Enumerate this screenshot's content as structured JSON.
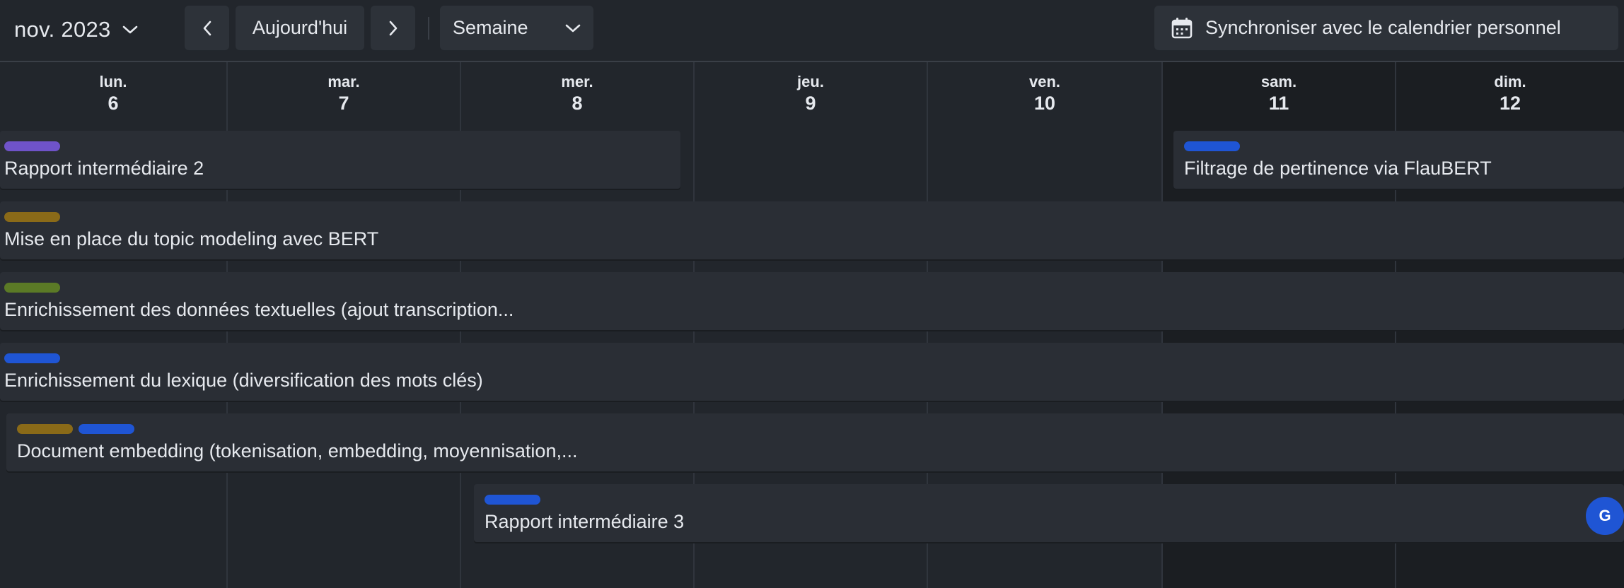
{
  "toolbar": {
    "month_label": "nov. 2023",
    "today_label": "Aujourd'hui",
    "view_label": "Semaine",
    "sync_label": "Synchroniser avec le calendrier personnel"
  },
  "days": [
    {
      "name": "lun.",
      "date": "6",
      "weekend": false
    },
    {
      "name": "mar.",
      "date": "7",
      "weekend": false
    },
    {
      "name": "mer.",
      "date": "8",
      "weekend": false
    },
    {
      "name": "jeu.",
      "date": "9",
      "weekend": false
    },
    {
      "name": "ven.",
      "date": "10",
      "weekend": false
    },
    {
      "name": "sam.",
      "date": "11",
      "weekend": true
    },
    {
      "name": "dim.",
      "date": "12",
      "weekend": true
    }
  ],
  "colors": {
    "purple": "#6f53c9",
    "olive_gold": "#8a6a18",
    "green": "#5b7a26",
    "blue": "#1f55d4"
  },
  "events": [
    {
      "title": "Rapport intermédiaire 2",
      "tags": [
        "#6f53c9"
      ]
    },
    {
      "title": "Filtrage de pertinence via FlauBERT",
      "tags": [
        "#1f55d4"
      ]
    },
    {
      "title": "Mise en place du topic modeling avec BERT",
      "tags": [
        "#8a6a18"
      ]
    },
    {
      "title": "Enrichissement des données textuelles (ajout transcription...",
      "tags": [
        "#5b7a26"
      ]
    },
    {
      "title": "Enrichissement du lexique (diversification des mots clés)",
      "tags": [
        "#1f55d4"
      ]
    },
    {
      "title": "Document embedding (tokenisation, embedding, moyennisation,...",
      "tags": [
        "#8a6a18",
        "#1f55d4"
      ]
    },
    {
      "title": "Rapport intermédiaire 3",
      "tags": [
        "#1f55d4"
      ],
      "avatar": "G"
    }
  ]
}
